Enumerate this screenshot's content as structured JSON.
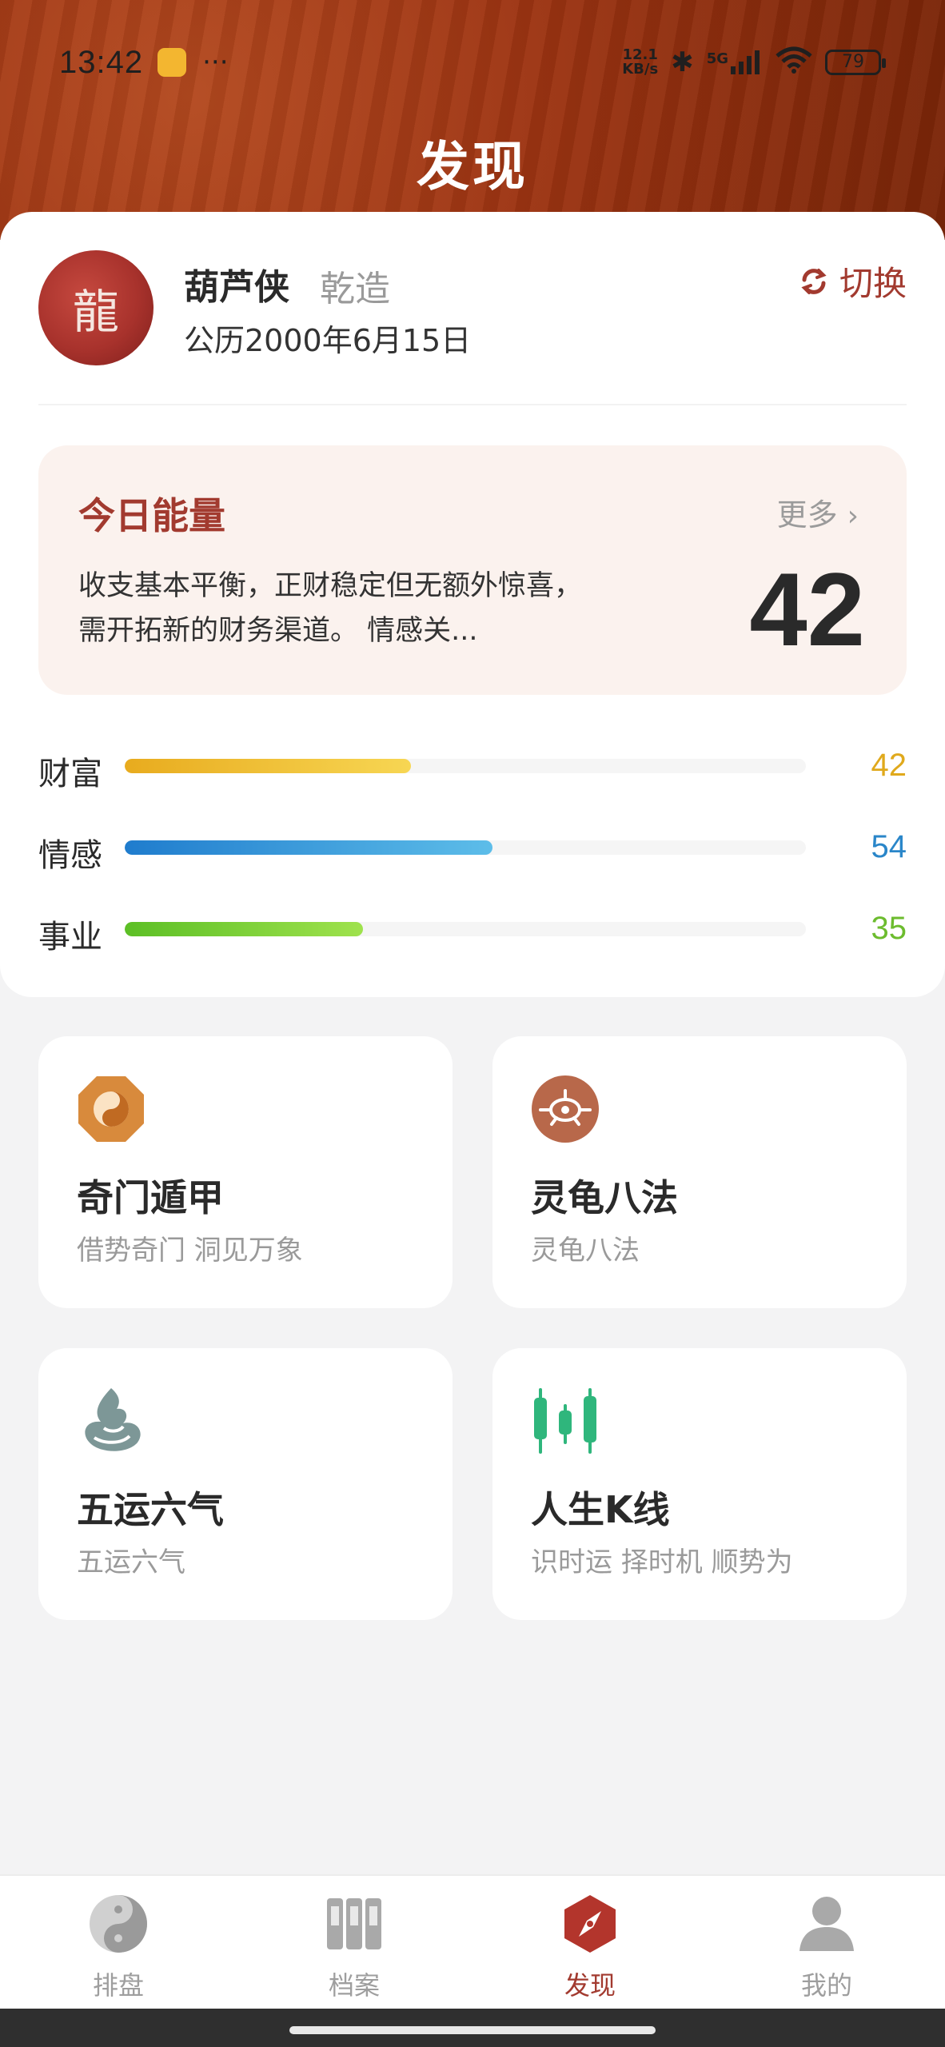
{
  "status": {
    "time": "13:42",
    "dots": "···",
    "net_speed": "12.1",
    "net_unit": "KB/s",
    "signal": "5G",
    "battery": "79"
  },
  "header": {
    "title": "发现"
  },
  "profile": {
    "avatar_glyph": "龍",
    "name": "葫芦侠",
    "gender": "乾造",
    "birth": "公历2000年6月15日",
    "switch_label": "切换"
  },
  "energy": {
    "title": "今日能量",
    "more_label": "更多",
    "description": "收支基本平衡，正财稳定但无额外惊喜，需开拓新的财务渠道。 情感关...",
    "score": "42"
  },
  "stats": [
    {
      "label": "财富",
      "value": "42",
      "color": "#e0a91c"
    },
    {
      "label": "情感",
      "value": "54",
      "color": "#2a86c9"
    },
    {
      "label": "事业",
      "value": "35",
      "color": "#6cbc2e"
    }
  ],
  "tiles": [
    {
      "title": "奇门遁甲",
      "subtitle": "借势奇门 洞见万象",
      "icon": "bagua-icon"
    },
    {
      "title": "灵龟八法",
      "subtitle": "灵龟八法",
      "icon": "turtle-icon"
    },
    {
      "title": "五运六气",
      "subtitle": "五运六气",
      "icon": "wind-swirl-icon"
    },
    {
      "title": "人生K线",
      "subtitle": "识时运 择时机 顺势为",
      "icon": "candlestick-icon"
    }
  ],
  "tabs": [
    {
      "label": "排盘",
      "icon": "yin-yang-icon"
    },
    {
      "label": "档案",
      "icon": "archive-icon"
    },
    {
      "label": "发现",
      "icon": "compass-icon",
      "active": true
    },
    {
      "label": "我的",
      "icon": "user-icon"
    }
  ],
  "colors": {
    "accent": "#a23a2f",
    "header_bg": "#9d3412"
  }
}
